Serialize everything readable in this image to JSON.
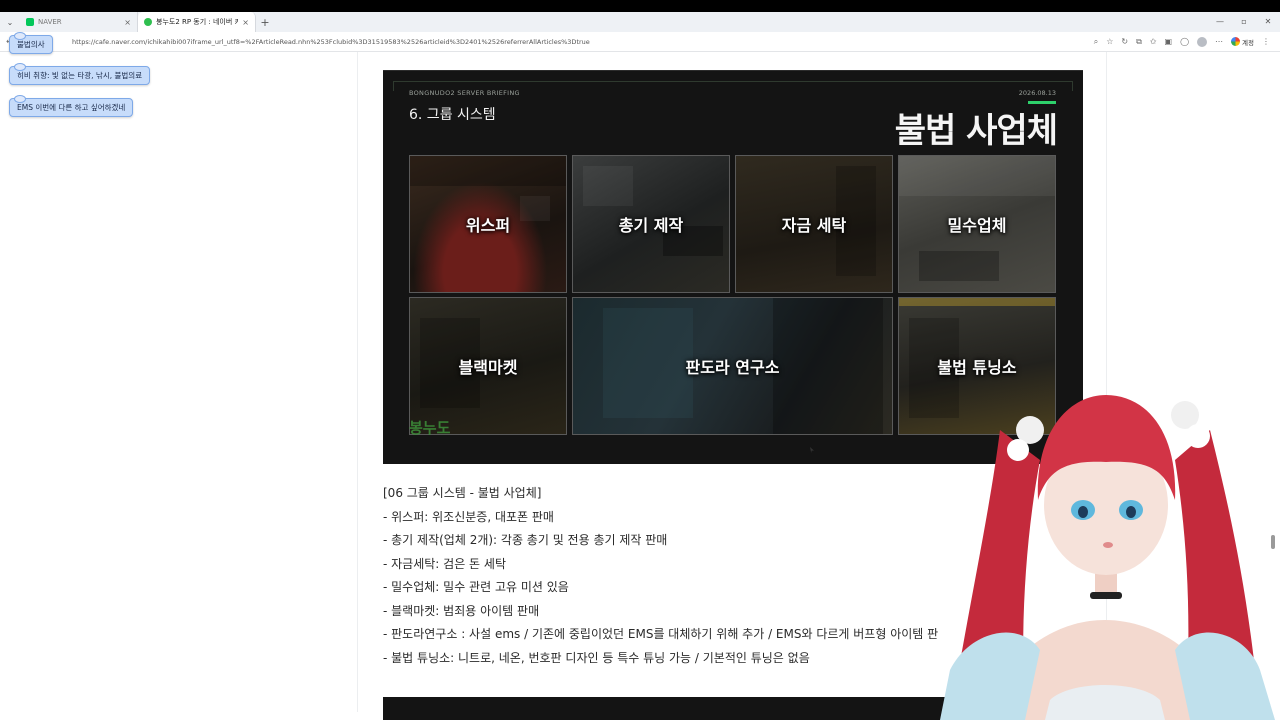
{
  "browser": {
    "tabs": [
      {
        "title": "NAVER",
        "close": "×"
      },
      {
        "title": "봉누도2 RP 동기 : 네이버 카페",
        "close": "×"
      }
    ],
    "new_tab": "+",
    "window_controls": [
      "—",
      "▫",
      "✕"
    ],
    "nav": [
      "←",
      "→",
      "↻"
    ],
    "url": "https://cafe.naver.com/ichikahibi007iframe_url_utf8=%2FArticleRead.nhn%253Fclubid%3D31519583%2526articleid%3D2401%2526referrerAllArticles%3Dtrue",
    "ext_label": "계정"
  },
  "overlay_chips": [
    "불법의사",
    "히비 취향: 빛 없는 타광, 낚시, 불법의료",
    "EMS 이번에 다른 하고 싶어하겠네"
  ],
  "slide": {
    "brief_label": "BONGNUDO2 SERVER BRIEFING",
    "date": "2026.08.13",
    "section": "6. 그룹 시스템",
    "heading": "불법 사업체",
    "tiles": [
      "위스퍼",
      "총기 제작",
      "자금 세탁",
      "밀수업체",
      "블랙마켓",
      "판도라 연구소",
      "불법 튜닝소"
    ],
    "logo": "봉누도"
  },
  "article_lines": [
    "[06 그룹 시스템 - 불법 사업체]",
    "- 위스퍼: 위조신분증, 대포폰 판매",
    "- 총기 제작(업체 2개): 각종 총기 및 전용 총기 제작 판매",
    "- 자금세탁: 검은 돈 세탁",
    "- 밀수업체: 밀수 관련 고유 미션 있음",
    "- 블랙마켓: 범죄용 아이템 판매",
    "- 판도라연구소 : 사설 ems / 기존에 중립이었던 EMS를 대체하기 위해 추가 / EMS와 다르게 버프형 아이템 판",
    "- 불법 튜닝소: 니트로, 네온, 번호판 디자인 등 특수 튜닝 가능 / 기본적인 튜닝은 없음"
  ]
}
